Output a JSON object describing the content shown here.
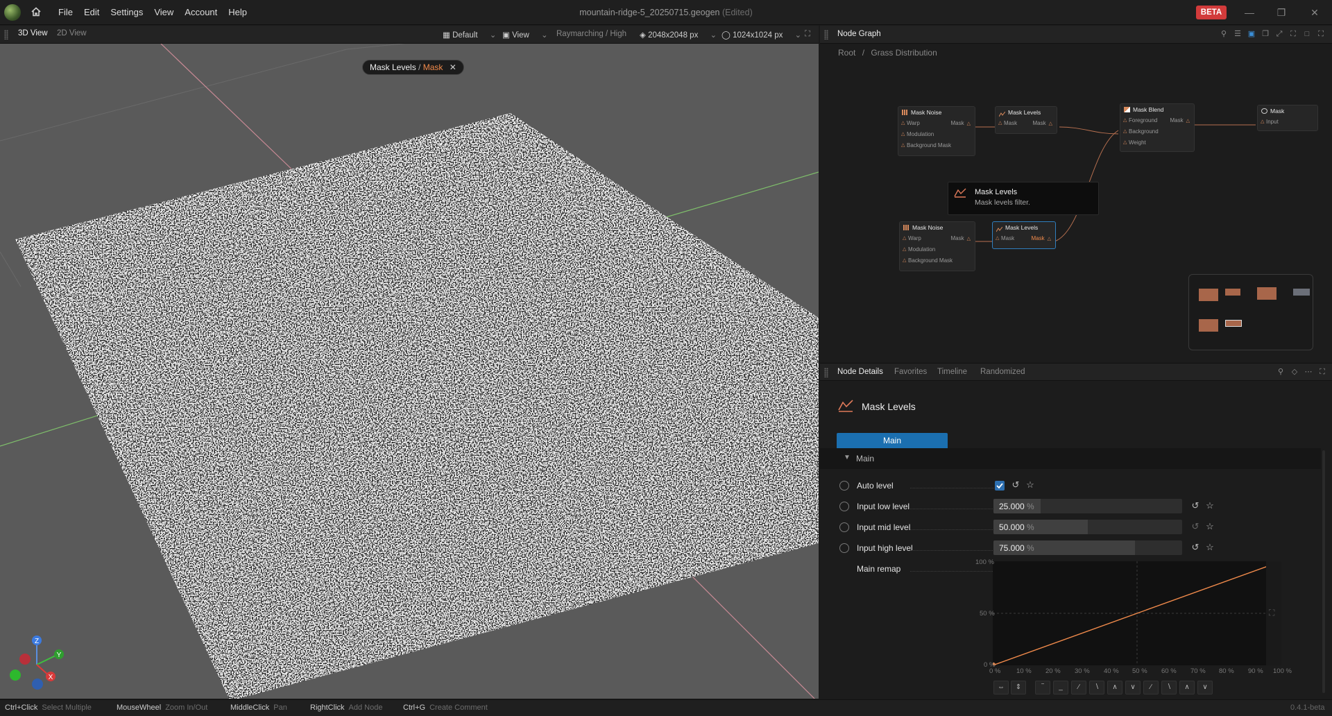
{
  "app": {
    "title": "mountain-ridge-5_20250715.geogen",
    "title_suffix": "(Edited)",
    "beta_badge": "BETA",
    "version": "0.4.1-beta"
  },
  "menu": [
    "File",
    "Edit",
    "Settings",
    "View",
    "Account",
    "Help"
  ],
  "viewport": {
    "tabs": [
      "3D View",
      "2D View"
    ],
    "toolbar": {
      "preset": "Default",
      "view": "View",
      "render_mode": "Raymarching / High",
      "texture_res": "2048x2048 px",
      "output_res": "1024x1024 px"
    },
    "pill": {
      "node": "Mask Levels",
      "sep": " / ",
      "port": "Mask"
    },
    "axes": {
      "z": "Z",
      "y": "Y",
      "x": "X"
    }
  },
  "node_graph": {
    "title": "Node Graph",
    "breadcrumb": [
      "Root",
      "/",
      "Grass Distribution"
    ],
    "nodes": {
      "noise1": {
        "title": "Mask Noise",
        "ports": [
          "Warp",
          "Modulation",
          "Background Mask"
        ],
        "output": "Mask"
      },
      "levels1": {
        "title": "Mask Levels",
        "ports": [
          "Mask"
        ],
        "output": "Mask"
      },
      "blend": {
        "title": "Mask Blend",
        "ports": [
          "Foreground",
          "Background",
          "Weight"
        ],
        "output": "Mask"
      },
      "mask_out": {
        "title": "Mask",
        "ports": [
          "Input"
        ]
      },
      "noise2": {
        "title": "Mask Noise",
        "ports": [
          "Warp",
          "Modulation",
          "Background Mask"
        ],
        "output": "Mask"
      },
      "levels2": {
        "title": "Mask Levels",
        "ports": [
          "Mask"
        ],
        "output": "Mask"
      }
    },
    "tooltip": {
      "title": "Mask Levels",
      "desc": "Mask levels filter."
    }
  },
  "node_details": {
    "tabs": [
      "Node Details",
      "Favorites",
      "Timeline",
      "Randomized"
    ],
    "node_title": "Mask Levels",
    "main_tab": "Main",
    "section": "Main",
    "params": {
      "auto_level": {
        "label": "Auto level",
        "checked": true
      },
      "low": {
        "label": "Input low level",
        "value": "25.000",
        "unit": "%",
        "fraction": 0.25
      },
      "mid": {
        "label": "Input mid level",
        "value": "50.000",
        "unit": "%",
        "fraction": 0.5
      },
      "high": {
        "label": "Input high level",
        "value": "75.000",
        "unit": "%",
        "fraction": 0.75
      },
      "remap": {
        "label": "Main remap"
      }
    },
    "curve": {
      "y_ticks": [
        "100 %",
        "50 %",
        "0 %"
      ],
      "x_ticks": [
        "0 %",
        "10 %",
        "20 %",
        "30 %",
        "40 %",
        "50 %",
        "60 %",
        "70 %",
        "80 %",
        "90 %",
        "100 %"
      ]
    }
  },
  "status_bar": [
    {
      "key": "Ctrl+Click",
      "action": "Select Multiple"
    },
    {
      "key": "MouseWheel",
      "action": "Zoom In/Out"
    },
    {
      "key": "MiddleClick",
      "action": "Pan"
    },
    {
      "key": "RightClick",
      "action": "Add Node"
    },
    {
      "key": "Ctrl+G",
      "action": "Create Comment"
    }
  ],
  "colors": {
    "accent": "#f08a4b",
    "selection": "#1b6fb0",
    "beta": "#d23b3b"
  }
}
